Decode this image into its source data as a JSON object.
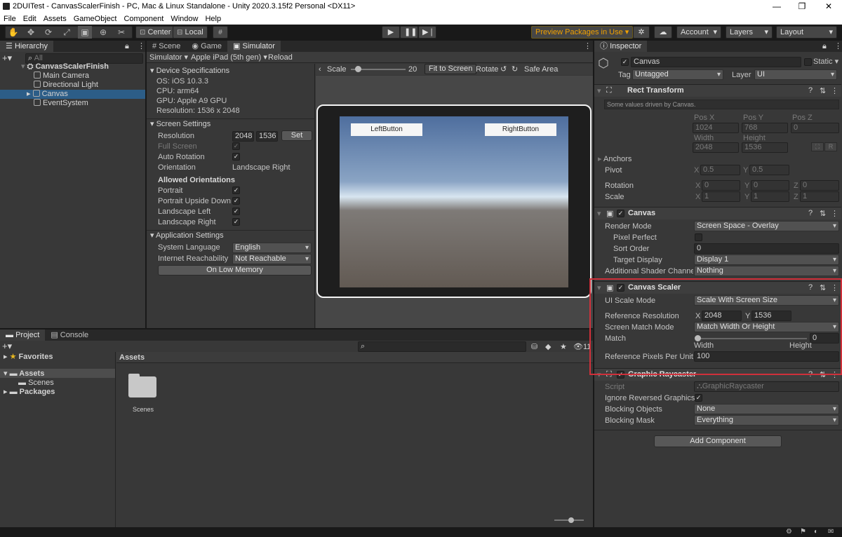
{
  "window": {
    "title": "2DUITest - CanvasScalerFinish - PC, Mac & Linux Standalone - Unity 2020.3.15f2 Personal <DX11>"
  },
  "menu": [
    "File",
    "Edit",
    "Assets",
    "GameObject",
    "Component",
    "Window",
    "Help"
  ],
  "toolbar": {
    "center": "Center",
    "local": "Local",
    "preview": "Preview Packages in Use",
    "account": "Account",
    "layers": "Layers",
    "layout": "Layout"
  },
  "hierarchy": {
    "tab": "Hierarchy",
    "search_placeholder": "All",
    "scene": "CanvasScalerFinish",
    "items": [
      "Main Camera",
      "Directional Light",
      "Canvas",
      "EventSystem"
    ]
  },
  "view_tabs": [
    "Scene",
    "Game",
    "Simulator"
  ],
  "simulator": {
    "mode": "Simulator",
    "device": "Apple iPad (5th gen)",
    "reload": "Reload",
    "scale_label": "Scale",
    "scale_value": "20",
    "fit": "Fit to Screen",
    "rotate": "Rotate",
    "safe_area": "Safe Area",
    "left_button": "LeftButton",
    "right_button": "RightButton",
    "device_spec": {
      "title": "Device Specifications",
      "os": "OS: iOS 10.3.3",
      "cpu": "CPU: arm64",
      "gpu": "GPU: Apple A9 GPU",
      "res": "Resolution: 1536 x 2048"
    },
    "screen_settings": {
      "title": "Screen Settings",
      "resolution_label": "Resolution",
      "res_w": "2048",
      "res_h": "1536",
      "set": "Set",
      "full_screen": "Full Screen",
      "auto_rotation": "Auto Rotation",
      "orientation_label": "Orientation",
      "orientation_value": "Landscape Right",
      "allowed": "Allowed Orientations",
      "portrait": "Portrait",
      "portrait_ud": "Portrait Upside Down",
      "land_left": "Landscape Left",
      "land_right": "Landscape Right"
    },
    "app_settings": {
      "title": "Application Settings",
      "lang_label": "System Language",
      "lang_value": "English",
      "reach_label": "Internet Reachability",
      "reach_value": "Not Reachable",
      "low_mem": "On Low Memory"
    }
  },
  "project": {
    "tabs": [
      "Project",
      "Console"
    ],
    "favorites": "Favorites",
    "assets": "Assets",
    "scenes": "Scenes",
    "packages": "Packages",
    "breadcrumb": "Assets",
    "folder": "Scenes",
    "hidden_count": "11"
  },
  "inspector": {
    "tab": "Inspector",
    "name": "Canvas",
    "static": "Static",
    "tag_label": "Tag",
    "tag": "Untagged",
    "layer_label": "Layer",
    "layer": "UI",
    "rect": {
      "title": "Rect Transform",
      "note": "Some values driven by Canvas.",
      "posx_l": "Pos X",
      "posy_l": "Pos Y",
      "posz_l": "Pos Z",
      "posx": "1024",
      "posy": "768",
      "posz": "0",
      "width_l": "Width",
      "height_l": "Height",
      "width": "2048",
      "height": "1536",
      "anchors": "Anchors",
      "pivot": "Pivot",
      "pivot_x": "0.5",
      "pivot_y": "0.5",
      "rotation": "Rotation",
      "rot_x": "0",
      "rot_y": "0",
      "rot_z": "0",
      "scale": "Scale",
      "sc_x": "1",
      "sc_y": "1",
      "sc_z": "1",
      "x": "X",
      "y": "Y",
      "z": "Z",
      "r": "R"
    },
    "canvas": {
      "title": "Canvas",
      "render_mode_l": "Render Mode",
      "render_mode": "Screen Space - Overlay",
      "pixel_perfect": "Pixel Perfect",
      "sort_order_l": "Sort Order",
      "sort_order": "0",
      "target_display_l": "Target Display",
      "target_display": "Display 1",
      "shader_ch_l": "Additional Shader Channels",
      "shader_ch": "Nothing"
    },
    "scaler": {
      "title": "Canvas Scaler",
      "ui_scale_l": "UI Scale Mode",
      "ui_scale": "Scale With Screen Size",
      "ref_res_l": "Reference Resolution",
      "ref_x": "2048",
      "ref_y": "1536",
      "match_mode_l": "Screen Match Mode",
      "match_mode": "Match Width Or Height",
      "match_l": "Match",
      "match": "0",
      "width": "Width",
      "height": "Height",
      "ppu_l": "Reference Pixels Per Unit",
      "ppu": "100"
    },
    "raycaster": {
      "title": "Graphic Raycaster",
      "script_l": "Script",
      "script": "GraphicRaycaster",
      "ignore_l": "Ignore Reversed Graphics",
      "blocking_obj_l": "Blocking Objects",
      "blocking_obj": "None",
      "blocking_mask_l": "Blocking Mask",
      "blocking_mask": "Everything"
    },
    "add_component": "Add Component"
  },
  "colors": {
    "accent": "#2c5d87",
    "highlight_red": "#d0303a",
    "bg": "#383838"
  }
}
